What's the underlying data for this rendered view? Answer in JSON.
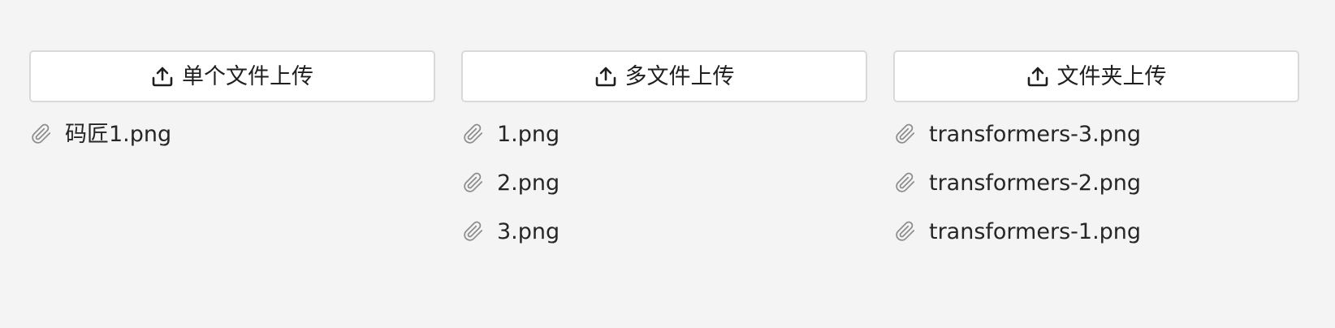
{
  "uploaders": [
    {
      "button_label": "单个文件上传",
      "button_icon": "upload-icon",
      "files": [
        "码匠1.png"
      ]
    },
    {
      "button_label": "多文件上传",
      "button_icon": "upload-icon",
      "files": [
        "1.png",
        "2.png",
        "3.png"
      ]
    },
    {
      "button_label": "文件夹上传",
      "button_icon": "upload-icon",
      "files": [
        "transformers-3.png",
        "transformers-2.png",
        "transformers-1.png"
      ]
    }
  ],
  "file_icon": "paperclip-icon",
  "colors": {
    "background": "#f4f4f4",
    "button_bg": "#ffffff",
    "button_border": "#d9d9d9",
    "text": "#1f1f1f",
    "icon_gray": "#8c8c8c"
  }
}
